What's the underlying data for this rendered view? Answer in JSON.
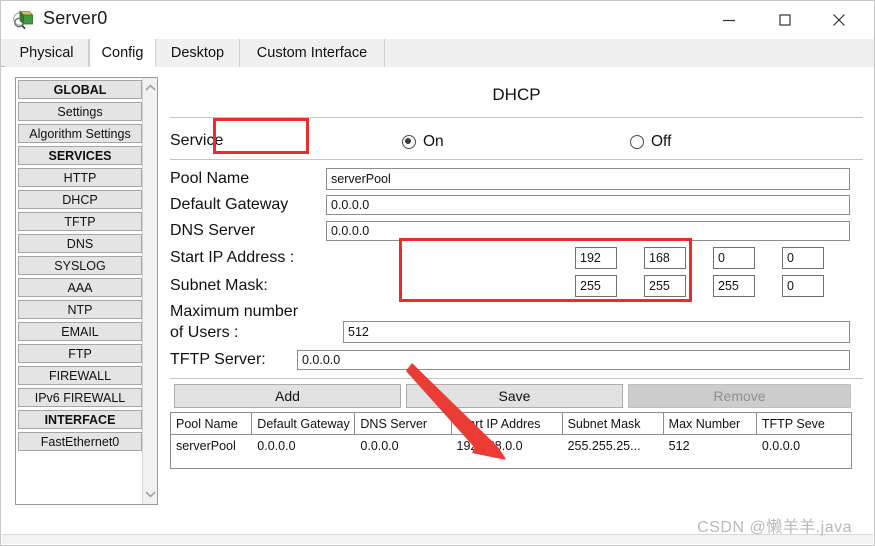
{
  "window": {
    "title": "Server0",
    "icon": "server-device-icon",
    "controls": {
      "minimize": "minimize-icon",
      "maximize": "maximize-icon",
      "close": "close-icon"
    }
  },
  "tabs": [
    {
      "label": "Physical",
      "active": false
    },
    {
      "label": "Config",
      "active": true
    },
    {
      "label": "Desktop",
      "active": false
    },
    {
      "label": "Custom Interface",
      "active": false
    }
  ],
  "sidebar": {
    "items": [
      {
        "label": "GLOBAL",
        "header": true
      },
      {
        "label": "Settings",
        "header": false
      },
      {
        "label": "Algorithm Settings",
        "header": false
      },
      {
        "label": "SERVICES",
        "header": true
      },
      {
        "label": "HTTP",
        "header": false
      },
      {
        "label": "DHCP",
        "header": false
      },
      {
        "label": "TFTP",
        "header": false
      },
      {
        "label": "DNS",
        "header": false
      },
      {
        "label": "SYSLOG",
        "header": false
      },
      {
        "label": "AAA",
        "header": false
      },
      {
        "label": "NTP",
        "header": false
      },
      {
        "label": "EMAIL",
        "header": false
      },
      {
        "label": "FTP",
        "header": false
      },
      {
        "label": "FIREWALL",
        "header": false
      },
      {
        "label": "IPv6 FIREWALL",
        "header": false
      },
      {
        "label": "INTERFACE",
        "header": true
      },
      {
        "label": "FastEthernet0",
        "header": false
      }
    ],
    "scroll": {
      "up": "chevron-up-icon",
      "down": "chevron-down-icon"
    }
  },
  "panel": {
    "title": "DHCP",
    "service": {
      "label": "Service",
      "on_label": "On",
      "off_label": "Off",
      "selected": "On"
    },
    "fields": {
      "pool_name": {
        "label": "Pool Name",
        "value": "serverPool"
      },
      "default_gateway": {
        "label": "Default Gateway",
        "value": "0.0.0.0"
      },
      "dns_server": {
        "label": "DNS Server",
        "value": "0.0.0.0"
      },
      "start_ip": {
        "label": "Start IP Address :",
        "octets": [
          "192",
          "168",
          "0",
          "0"
        ]
      },
      "subnet_mask": {
        "label": "Subnet Mask:",
        "octets": [
          "255",
          "255",
          "255",
          "0"
        ]
      },
      "max_users": {
        "label_line1": "Maximum number",
        "label_line2": " of Users :",
        "value": "512"
      },
      "tftp_server": {
        "label": "TFTP Server:",
        "value": "0.0.0.0"
      }
    },
    "buttons": {
      "add": {
        "label": "Add",
        "disabled": false
      },
      "save": {
        "label": "Save",
        "disabled": false
      },
      "remove": {
        "label": "Remove",
        "disabled": true
      }
    },
    "table": {
      "headers": [
        "Pool Name",
        "Default Gateway",
        "DNS Server",
        "Start IP Addres",
        "Subnet Mask",
        "Max Number",
        "TFTP Seve"
      ],
      "rows": [
        [
          "serverPool",
          "0.0.0.0",
          "0.0.0.0",
          "192.168.0.0",
          "255.255.25...",
          "512",
          "0.0.0.0"
        ]
      ]
    }
  },
  "annotations": {
    "highlight_color": "#ec2b2b",
    "boxes": [
      "service-on-highlight",
      "ip-octets-highlight"
    ],
    "arrow": "arrow-pointing-to-save-button"
  },
  "watermark": {
    "text": "CSDN @懒羊羊.java",
    "color": "#b9b9b9"
  }
}
